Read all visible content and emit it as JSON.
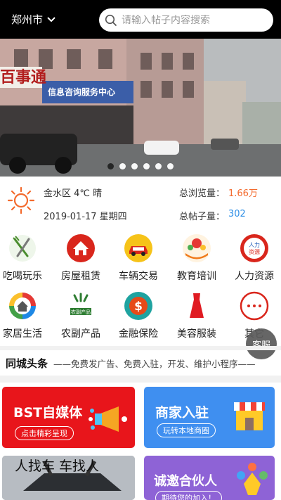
{
  "header": {
    "city": "郑州市",
    "search_placeholder": "请输入帖子内容搜索"
  },
  "banner": {
    "sign_text": "百事通",
    "sign_sub": "信息咨询服务中心",
    "dots": 6,
    "active_dot": 0
  },
  "info": {
    "weather": "金水区 4℃ 晴",
    "date": "2019-01-17 星期四",
    "views_label": "总浏览量：",
    "views_value": "1.66万",
    "posts_label": "总帖子量：",
    "posts_value": "302"
  },
  "categories": [
    {
      "label": "吃喝玩乐",
      "icon": "fork-knife-icon"
    },
    {
      "label": "房屋租赁",
      "icon": "house-icon"
    },
    {
      "label": "车辆交易",
      "icon": "car-icon"
    },
    {
      "label": "教育培训",
      "icon": "education-icon"
    },
    {
      "label": "人力资源",
      "icon": "human-resources-icon"
    },
    {
      "label": "家居生活",
      "icon": "home-life-icon"
    },
    {
      "label": "农副产品",
      "icon": "farm-product-icon"
    },
    {
      "label": "金融保险",
      "icon": "dollar-icon"
    },
    {
      "label": "美容服装",
      "icon": "dress-icon"
    },
    {
      "label": "其它",
      "icon": "more-icon"
    }
  ],
  "kefu": "客服",
  "headline": {
    "title": "同城头条",
    "desc": "——免费发广告、免费入驻，开发、维护小程序——"
  },
  "cards": [
    {
      "title": "BST自媒体",
      "button": "点击精彩呈现"
    },
    {
      "title": "商家入驻",
      "button": "玩转本地商圈"
    },
    {
      "title": "人找车 车找人",
      "button": ""
    },
    {
      "title": "诚邀合伙人",
      "button": "期待您的加入！"
    }
  ],
  "colors": {
    "accent_orange": "#f36a2d",
    "accent_blue": "#2f8fe6",
    "card_red": "#e8151b",
    "card_blue": "#3f8ff0",
    "card_purple": "#8e63d6"
  }
}
